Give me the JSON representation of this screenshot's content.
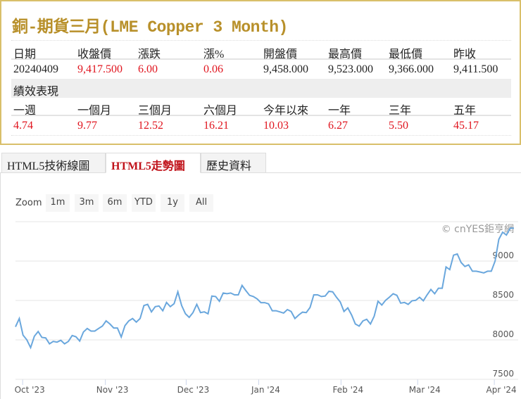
{
  "quote": {
    "title": "銅-期貨三月(LME Copper 3 Month)",
    "headers": [
      "日期",
      "收盤價",
      "漲跌",
      "漲%",
      "開盤價",
      "最高價",
      "最低價",
      "昨收"
    ],
    "values": [
      "20240409",
      "9,417.500",
      "6.00",
      "0.06",
      "9,458.000",
      "9,523.000",
      "9,366.000",
      "9,411.500"
    ],
    "perf_title": "績效表現",
    "perf_headers": [
      "一週",
      "一個月",
      "三個月",
      "六個月",
      "今年以來",
      "一年",
      "三年",
      "五年"
    ],
    "perf_values": [
      "4.74",
      "9.77",
      "12.52",
      "16.21",
      "10.03",
      "6.27",
      "5.50",
      "45.17"
    ]
  },
  "tabs": [
    {
      "label": "HTML5技術線圖"
    },
    {
      "label": "HTML5走勢圖",
      "active": true
    },
    {
      "label": "歷史資料"
    }
  ],
  "zoom": {
    "label": "Zoom",
    "buttons": [
      "1m",
      "3m",
      "6m",
      "YTD",
      "1y",
      "All"
    ]
  },
  "watermark": "© cnYES鉅亨網",
  "colors": {
    "line": "#6aa7dd",
    "gold": "#b8902a",
    "up": "#e0141e"
  },
  "chart_data": {
    "type": "line",
    "title": "",
    "ylim": [
      7500,
      9500
    ],
    "yticks": [
      7500,
      8000,
      8500,
      9000
    ],
    "ytick_labels": [
      "7500",
      "8000",
      "8500",
      "9000"
    ],
    "xticks": [
      {
        "label": "Oct '23",
        "index": 1.9
      },
      {
        "label": "Nov '23",
        "index": 23.8
      },
      {
        "label": "Dec '23",
        "index": 45.2
      },
      {
        "label": "Jan '24",
        "index": 64.4
      },
      {
        "label": "Feb '24",
        "index": 86.2
      },
      {
        "label": "Mar '24",
        "index": 106.5
      },
      {
        "label": "Apr '24",
        "index": 126.8
      }
    ],
    "series": [
      {
        "name": "LME Copper 3 Month",
        "values": [
          8166,
          8271,
          8061,
          8001,
          7902,
          8046,
          8106,
          8031,
          8025,
          7950,
          7980,
          7971,
          7995,
          7950,
          7980,
          8055,
          8040,
          7986,
          8100,
          8145,
          8112,
          8112,
          8145,
          8175,
          8241,
          8202,
          8151,
          8151,
          8037,
          8181,
          8241,
          8271,
          8226,
          8271,
          8436,
          8451,
          8355,
          8421,
          8430,
          8370,
          8475,
          8421,
          8460,
          8610,
          8436,
          8331,
          8286,
          8346,
          8451,
          8346,
          8355,
          8331,
          8556,
          8550,
          8490,
          8595,
          8586,
          8595,
          8571,
          8571,
          8691,
          8625,
          8565,
          8550,
          8520,
          8472,
          8472,
          8457,
          8370,
          8370,
          8355,
          8340,
          8385,
          8361,
          8271,
          8316,
          8352,
          8346,
          8412,
          8571,
          8571,
          8550,
          8556,
          8616,
          8610,
          8541,
          8481,
          8361,
          8406,
          8316,
          8202,
          8175,
          8241,
          8262,
          8202,
          8301,
          8490,
          8442,
          8502,
          8541,
          8586,
          8565,
          8466,
          8475,
          8451,
          8496,
          8502,
          8541,
          8496,
          8571,
          8640,
          8586,
          8655,
          8655,
          8925,
          8892,
          9075,
          9090,
          8982,
          8931,
          8952,
          8871,
          8871,
          8862,
          8850,
          8871,
          8871,
          9000,
          9276,
          9366,
          9330,
          9417,
          9417
        ]
      }
    ]
  }
}
